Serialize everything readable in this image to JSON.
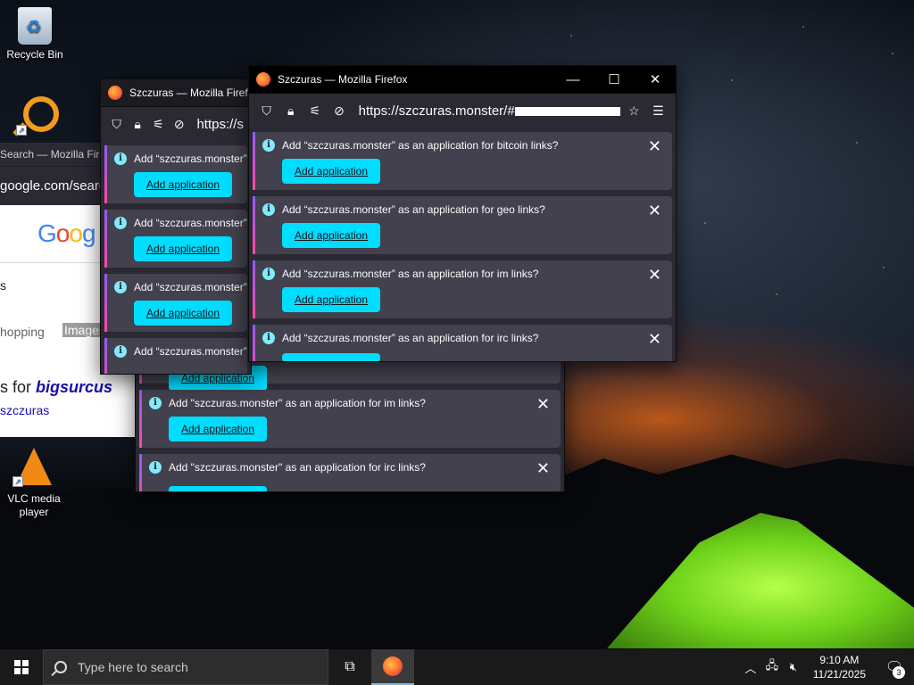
{
  "desktop": {
    "icons": [
      {
        "label": "Recycle Bin",
        "icon": "recycle-bin-icon"
      },
      {
        "label": "",
        "icon": "search-app-icon"
      },
      {
        "label": "VLC media player",
        "icon": "vlc-icon"
      }
    ]
  },
  "google_window": {
    "title": "Search — Mozilla Firef",
    "url": "google.com/search",
    "logo": "Goog",
    "search_suffix": "s",
    "tab_shopping": "hopping",
    "tab_images": "Images",
    "result_prefix": "s for ",
    "result_query": "bigsurcus",
    "result_sub": "szczuras"
  },
  "ff_back": {
    "title": "Szczuras — Mozilla Firefox",
    "url": "https://s",
    "notifications": [
      {
        "text": "Add “szczuras.monster”",
        "button": "Add application"
      },
      {
        "text": "Add “szczuras.monster”",
        "button": "Add application"
      },
      {
        "text": "Add “szczuras.monster”",
        "button": "Add application"
      },
      {
        "text": "Add “szczuras.monster”",
        "button": ""
      }
    ]
  },
  "ff_mid": {
    "notifications": [
      {
        "text": "",
        "button": "Add application"
      },
      {
        "text": "Add \"szczuras.monster\" as an application for im links?",
        "button": "Add application"
      },
      {
        "text": "Add \"szczuras.monster\" as an application for irc links?",
        "button": ""
      }
    ]
  },
  "ff_front": {
    "title": "Szczuras — Mozilla Firefox",
    "url": "https://szczuras.monster/#",
    "notifications": [
      {
        "text": "Add “szczuras.monster” as an application for bitcoin links?",
        "button": "Add application"
      },
      {
        "text": "Add “szczuras.monster” as an application for geo links?",
        "button": "Add application"
      },
      {
        "text": "Add “szczuras.monster” as an application for im links?",
        "button": "Add application"
      },
      {
        "text": "Add “szczuras.monster” as an application for irc links?",
        "button": ""
      }
    ]
  },
  "taskbar": {
    "search_placeholder": "Type here to search",
    "time": "9:10 AM",
    "date": "11/21/2025",
    "notification_count": "3"
  }
}
